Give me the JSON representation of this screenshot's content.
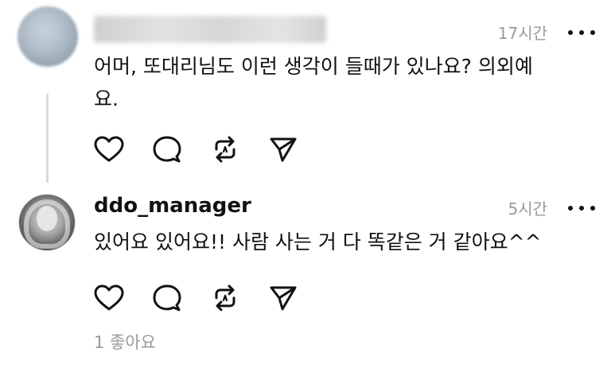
{
  "comment1": {
    "time": "17시간",
    "text_line1": "어머, 또대리님도 이런 생각이 들때가 있나요? 의외예",
    "text_line2": "요."
  },
  "comment2": {
    "username": "ddo_manager",
    "time": "5시간",
    "text": "있어요 있어요!! 사람 사는 거 다 똑같은 거 같아요^^",
    "likes": "1 좋아요"
  },
  "icons": {
    "like": "heart-icon",
    "reply": "comment-bubble-icon",
    "repost": "repost-icon",
    "share": "send-icon",
    "more": "more-dots-icon"
  }
}
